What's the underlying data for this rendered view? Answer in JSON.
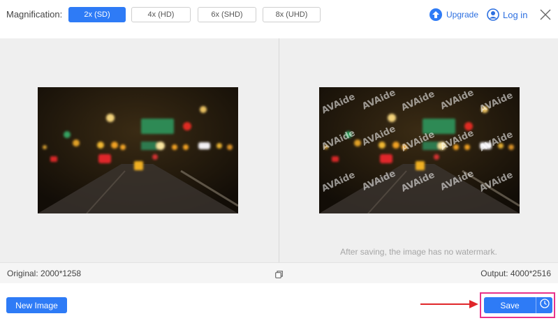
{
  "topbar": {
    "magnification_label": "Magnification:",
    "options": [
      {
        "label": "2x (SD)",
        "active": true
      },
      {
        "label": "4x (HD)",
        "active": false
      },
      {
        "label": "6x (SHD)",
        "active": false
      },
      {
        "label": "8x (UHD)",
        "active": false
      }
    ],
    "upgrade_label": "Upgrade",
    "login_label": "Log in",
    "accent_color": "#2e7bf6"
  },
  "preview": {
    "watermark_text": "AVAide",
    "watermark_note": "After saving, the image has no watermark."
  },
  "infobar": {
    "original_label": "Original: 2000*1258",
    "output_label": "Output: 4000*2516"
  },
  "bottombar": {
    "new_image_label": "New Image",
    "save_label": "Save",
    "highlight_color": "#e8318a"
  },
  "icons": {
    "upgrade": "upgrade-arrow-icon",
    "login": "user-circle-icon",
    "close": "close-icon",
    "compare": "compare-icon",
    "history": "clock-icon",
    "annotation_arrow": "red-arrow-icon"
  }
}
